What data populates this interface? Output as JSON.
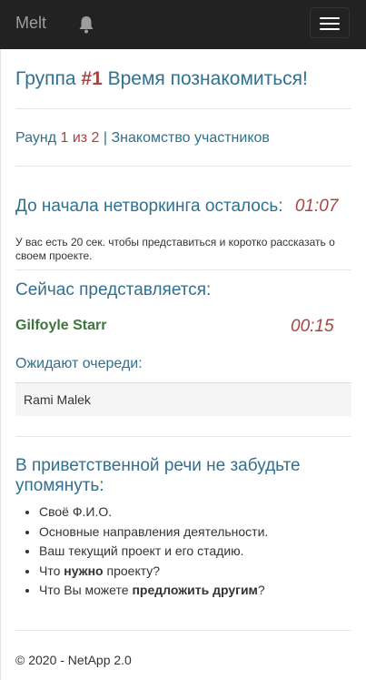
{
  "navbar": {
    "brand": "Melt",
    "notification_icon": "bell-icon",
    "menu_icon": "hamburger-menu-icon"
  },
  "group": {
    "prefix": "Группа",
    "number": "#1",
    "suffix": "Время познакомиться!"
  },
  "round": {
    "label": "Раунд",
    "progress": "1 из 2",
    "separator": "|",
    "title": "Знакомство участников"
  },
  "networking": {
    "heading": "До начала нетворкинга осталось:",
    "timer": "01:07",
    "note": "У вас есть 20 сек. чтобы представиться и коротко рассказать о своем проекте."
  },
  "current": {
    "heading": "Сейчас представляется:",
    "speaker": "Gilfoyle Starr",
    "timer": "00:15"
  },
  "queue": {
    "heading": "Ожидают очереди:",
    "items": [
      "Rami Malek"
    ]
  },
  "reminder": {
    "heading": "В приветственной речи не забудьте упомянуть:",
    "item1": "Своё Ф.И.О.",
    "item2": "Основные направления деятельности.",
    "item3": "Ваш текущий проект и его стадию.",
    "item4_pre": "Что ",
    "item4_bold": "нужно",
    "item4_post": " проекту?",
    "item5_pre": "Что Вы можете ",
    "item5_bold": "предложить другим",
    "item5_post": "?"
  },
  "footer": {
    "text": "© 2020 - NetApp 2.0"
  },
  "colors": {
    "navbar_bg": "#222222",
    "heading_blue": "#31708f",
    "accent_red": "#a94442",
    "speaker_green": "#3c763d"
  }
}
